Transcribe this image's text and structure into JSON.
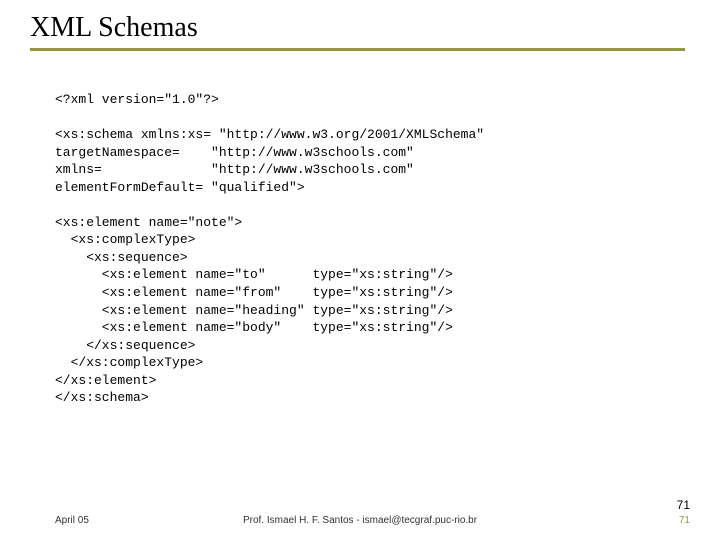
{
  "title": "XML Schemas",
  "code": "<?xml version=\"1.0\"?>\n\n<xs:schema xmlns:xs= \"http://www.w3.org/2001/XMLSchema\"\ntargetNamespace=    \"http://www.w3schools.com\"\nxmlns=              \"http://www.w3schools.com\"\nelementFormDefault= \"qualified\">\n\n<xs:element name=\"note\">\n  <xs:complexType>\n    <xs:sequence>\n      <xs:element name=\"to\"      type=\"xs:string\"/>\n      <xs:element name=\"from\"    type=\"xs:string\"/>\n      <xs:element name=\"heading\" type=\"xs:string\"/>\n      <xs:element name=\"body\"    type=\"xs:string\"/>\n    </xs:sequence>\n  </xs:complexType>\n</xs:element>\n</xs:schema>",
  "footer": {
    "date": "April 05",
    "author": "Prof. Ismael H. F. Santos - ismael@tecgraf.puc-rio.br",
    "page_top": "71",
    "page_bottom": "71"
  }
}
